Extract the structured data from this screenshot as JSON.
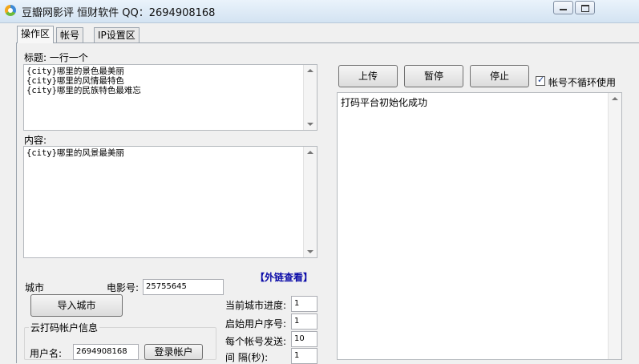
{
  "window": {
    "title": "豆瓣网影评  恒财软件 QQ：2694908168"
  },
  "tabs": [
    {
      "label": "操作区"
    },
    {
      "label": "帐号"
    },
    {
      "label": "IP设置区"
    }
  ],
  "title_section": {
    "label": "标题: 一行一个",
    "lines": [
      "{city}哪里的景色最美丽",
      "{city}哪里的风情最特色",
      "{city}哪里的民族特色最难忘"
    ]
  },
  "content_section": {
    "label": "内容:",
    "lines": [
      "{city}哪里的风景最美丽"
    ]
  },
  "controls": {
    "upload": "上传",
    "pause": "暂停",
    "stop": "停止",
    "no_loop_label": "帐号不循环使用",
    "no_loop_checked": true
  },
  "log": {
    "text": "打码平台初始化成功"
  },
  "city": {
    "label": "城市",
    "movie_label": "电影号:",
    "movie_value": "25755645",
    "external_link": "【外链查看】",
    "import_button": "导入城市"
  },
  "settings": {
    "progress_label": "当前城市进度:",
    "progress_value": "1",
    "start_user_label": "启始用户序号:",
    "start_user_value": "1",
    "per_account_label": "每个帐号发送:",
    "per_account_value": "10",
    "interval_label": "间  隔(秒):",
    "interval_value": "1"
  },
  "captcha_account": {
    "group_label": "云打码帐户信息",
    "username_label": "用户名:",
    "username_value": "2694908168",
    "login_button": "登录帐户"
  }
}
